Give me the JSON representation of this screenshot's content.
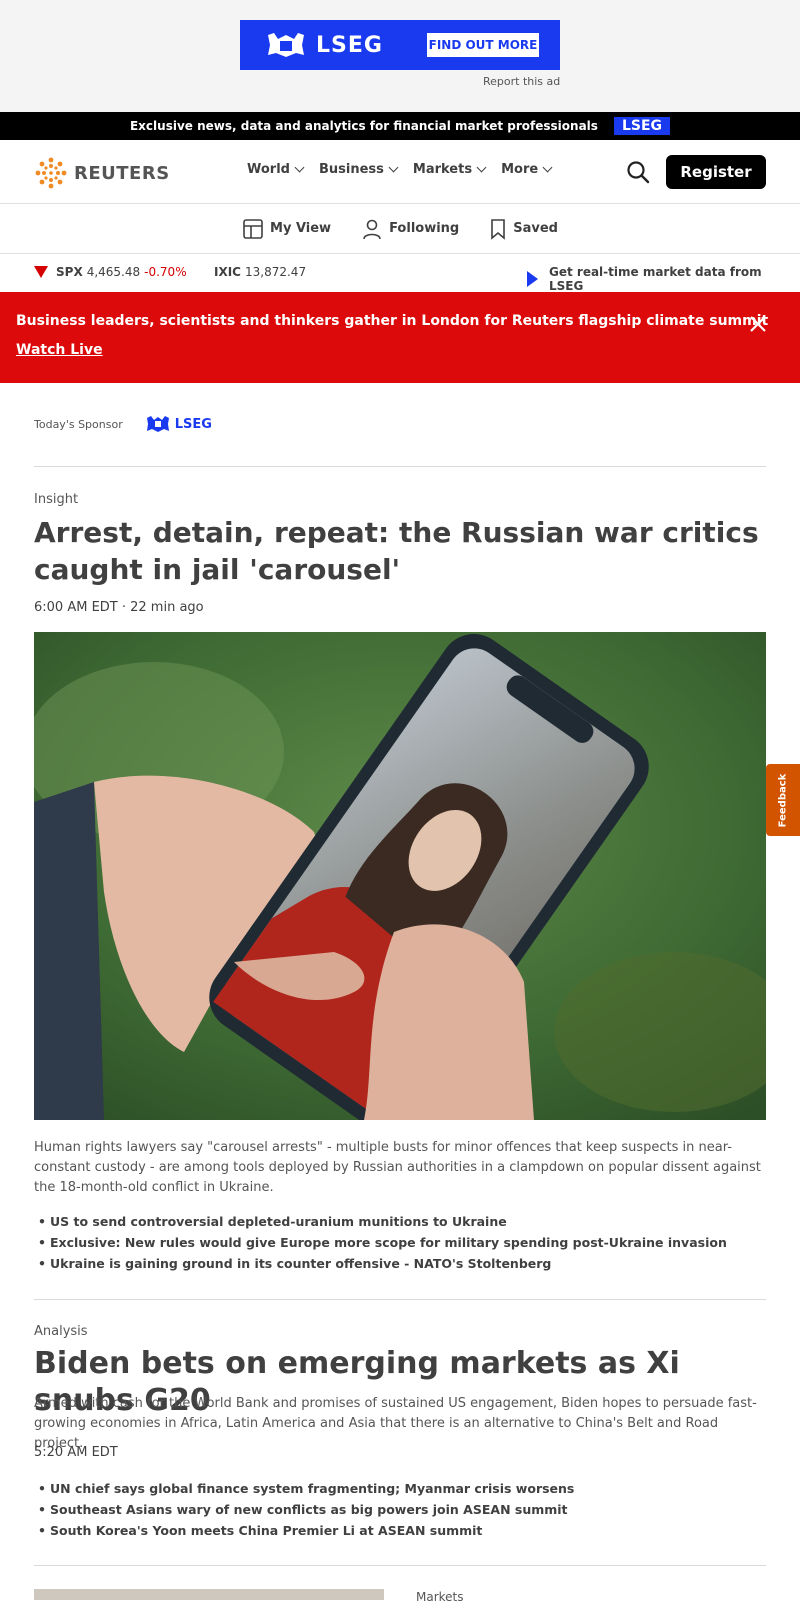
{
  "ad": {
    "brand": "LSEG",
    "cta": "FIND OUT MORE",
    "report": "Report this ad"
  },
  "promo_bar": {
    "text": "Exclusive news, data and analytics for financial market professionals",
    "badge": "LSEG"
  },
  "header": {
    "logo_text": "REUTERS",
    "nav": [
      {
        "label": "World"
      },
      {
        "label": "Business"
      },
      {
        "label": "Markets"
      },
      {
        "label": "More"
      }
    ],
    "register": "Register"
  },
  "subnav": [
    {
      "label": "My View"
    },
    {
      "label": "Following"
    },
    {
      "label": "Saved"
    }
  ],
  "ticker": {
    "spx": {
      "name": "SPX",
      "value": "4,465.48",
      "change": "-0.70%"
    },
    "ixic": {
      "name": "IXIC",
      "value": "13,872.47"
    },
    "lseg_link": "Get real-time market data from LSEG"
  },
  "alert": {
    "text": "Business leaders, scientists and thinkers gather in London for Reuters flagship climate summit",
    "link": "Watch Live"
  },
  "sponsor": {
    "label": "Today's Sponsor",
    "brand": "LSEG"
  },
  "article1": {
    "kicker": "Insight",
    "headline": "Arrest, detain, repeat: the Russian war critics caught in jail 'carousel'",
    "meta": "6:00 AM EDT · 22 min ago",
    "summary": "Human rights lawyers say \"carousel arrests\" - multiple busts for minor offences that keep suspects in near-constant custody - are among tools deployed by Russian authorities in a clampdown on popular dissent against the 18-month-old conflict in Ukraine.",
    "related": [
      "US to send controversial depleted-uranium munitions to Ukraine",
      "Exclusive: New rules would give Europe more scope for military spending post-Ukraine invasion",
      "Ukraine is gaining ground in its counter offensive - NATO's Stoltenberg"
    ]
  },
  "article2": {
    "kicker": "Analysis",
    "headline": "Biden bets on emerging markets as Xi snubs G20",
    "summary": "Armed with cash for the World Bank and promises of sustained US engagement, Biden hopes to persuade fast-growing economies in Africa, Latin America and Asia that there is an alternative to China's Belt and Road project.",
    "meta": "5:20 AM EDT",
    "related": [
      "UN chief says global finance system fragmenting; Myanmar crisis worsens",
      "Southeast Asians wary of new conflicts as big powers join ASEAN summit",
      "South Korea's Yoon meets China Premier Li at ASEAN summit"
    ]
  },
  "article3": {
    "kicker": "Markets"
  },
  "feedback": "Feedback"
}
